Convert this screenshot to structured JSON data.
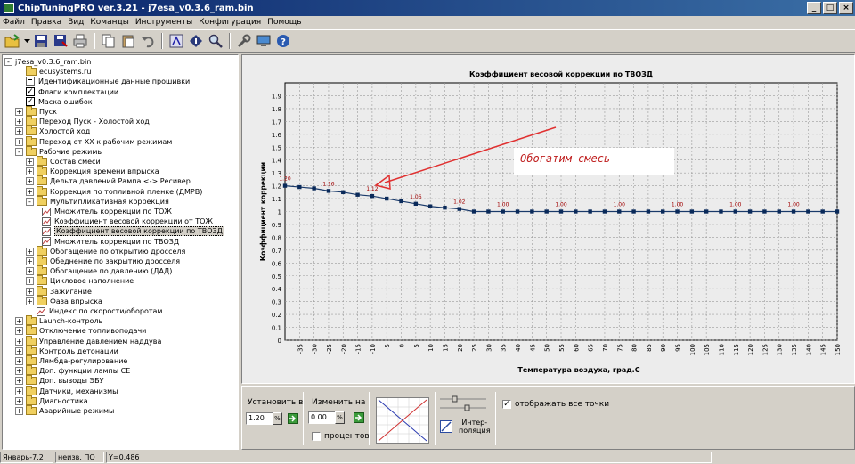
{
  "window": {
    "title": "ChipTuningPRO ver.3.21 - j7esa_v0.3.6_ram.bin",
    "buttons": {
      "minimize": "_",
      "maximize": "□",
      "close": "×"
    }
  },
  "menu": [
    "Файл",
    "Правка",
    "Вид",
    "Команды",
    "Инструменты",
    "Конфигурация",
    "Помощь"
  ],
  "toolbar_icons": [
    "open-icon",
    "dropdown-icon",
    "save-icon",
    "save-as-icon",
    "print-icon",
    "copy-icon",
    "paste-icon",
    "undo-icon",
    "find-icon",
    "info-icon",
    "zoom-icon",
    "tools-icon",
    "monitor-icon",
    "help-icon"
  ],
  "tree": [
    {
      "label": "j7esa_v0.3.6_ram.bin",
      "level": 0,
      "toggle": "-",
      "icon": "none"
    },
    {
      "label": "ecusystems.ru",
      "level": 1,
      "toggle": "",
      "icon": "folder"
    },
    {
      "label": "Идентификационные данные прошивки",
      "level": 1,
      "toggle": "",
      "icon": "doc"
    },
    {
      "label": "Флаги комплектации",
      "level": 1,
      "toggle": "",
      "icon": "check"
    },
    {
      "label": "Маска ошибок",
      "level": 1,
      "toggle": "",
      "icon": "check"
    },
    {
      "label": "Пуск",
      "level": 1,
      "toggle": "+",
      "icon": "folder"
    },
    {
      "label": "Переход Пуск - Холостой ход",
      "level": 1,
      "toggle": "+",
      "icon": "folder"
    },
    {
      "label": "Холостой ход",
      "level": 1,
      "toggle": "+",
      "icon": "folder"
    },
    {
      "label": "Переход от ХХ к рабочим режимам",
      "level": 1,
      "toggle": "+",
      "icon": "folder"
    },
    {
      "label": "Рабочие режимы",
      "level": 1,
      "toggle": "-",
      "icon": "folder"
    },
    {
      "label": "Состав смеси",
      "level": 2,
      "toggle": "+",
      "icon": "folder"
    },
    {
      "label": "Коррекция времени впрыска",
      "level": 2,
      "toggle": "+",
      "icon": "folder"
    },
    {
      "label": "Дельта давлений Рампа <-> Ресивер",
      "level": 2,
      "toggle": "+",
      "icon": "folder"
    },
    {
      "label": "Коррекция по топливной пленке (ДМРВ)",
      "level": 2,
      "toggle": "+",
      "icon": "folder"
    },
    {
      "label": "Мультипликативная коррекция",
      "level": 2,
      "toggle": "-",
      "icon": "folder"
    },
    {
      "label": "Множитель коррекции по ТОЖ",
      "level": 3,
      "toggle": "",
      "icon": "graph"
    },
    {
      "label": "Коэффициент весовой коррекции от ТОЖ",
      "level": 3,
      "toggle": "",
      "icon": "graph"
    },
    {
      "label": "Коэффициент весовой коррекции по ТВОЗД",
      "level": 3,
      "toggle": "",
      "icon": "graph",
      "selected": true
    },
    {
      "label": "Множитель коррекции по ТВОЗД",
      "level": 3,
      "toggle": "",
      "icon": "graph"
    },
    {
      "label": "Обогащение по открытию дросселя",
      "level": 2,
      "toggle": "+",
      "icon": "folder"
    },
    {
      "label": "Обеднение по закрытию дросселя",
      "level": 2,
      "toggle": "+",
      "icon": "folder"
    },
    {
      "label": "Обогащение по давлению (ДАД)",
      "level": 2,
      "toggle": "+",
      "icon": "folder"
    },
    {
      "label": "Цикловое наполнение",
      "level": 2,
      "toggle": "+",
      "icon": "folder"
    },
    {
      "label": "Зажигание",
      "level": 2,
      "toggle": "+",
      "icon": "folder"
    },
    {
      "label": "Фаза впрыска",
      "level": 2,
      "toggle": "+",
      "icon": "folder"
    },
    {
      "label": "Индекс по скорости/оборотам",
      "level": 2,
      "toggle": "",
      "icon": "graph"
    },
    {
      "label": "Launch-контроль",
      "level": 1,
      "toggle": "+",
      "icon": "folder"
    },
    {
      "label": "Отключение топливоподачи",
      "level": 1,
      "toggle": "+",
      "icon": "folder"
    },
    {
      "label": "Управление давлением наддува",
      "level": 1,
      "toggle": "+",
      "icon": "folder"
    },
    {
      "label": "Контроль детонации",
      "level": 1,
      "toggle": "+",
      "icon": "folder"
    },
    {
      "label": "Лямбда-регулирование",
      "level": 1,
      "toggle": "+",
      "icon": "folder"
    },
    {
      "label": "Доп. функции лампы CE",
      "level": 1,
      "toggle": "+",
      "icon": "folder"
    },
    {
      "label": "Доп. выводы ЭБУ",
      "level": 1,
      "toggle": "+",
      "icon": "folder"
    },
    {
      "label": "Датчики, механизмы",
      "level": 1,
      "toggle": "+",
      "icon": "folder"
    },
    {
      "label": "Диагностика",
      "level": 1,
      "toggle": "+",
      "icon": "folder"
    },
    {
      "label": "Аварийные режимы",
      "level": 1,
      "toggle": "+",
      "icon": "folder"
    }
  ],
  "chart_data": {
    "type": "line",
    "title": "Коэффициент весовой коррекции по ТВОЗД",
    "xlabel": "Температура воздуха, град.С",
    "ylabel": "Коэффициент коррекции",
    "x": [
      -40,
      -35,
      -30,
      -25,
      -20,
      -15,
      -10,
      -5,
      0,
      5,
      10,
      15,
      20,
      25,
      30,
      35,
      40,
      45,
      50,
      55,
      60,
      65,
      70,
      75,
      80,
      85,
      90,
      95,
      100,
      105,
      110,
      115,
      120,
      125,
      130,
      135,
      140,
      145,
      150
    ],
    "values": [
      1.2,
      1.19,
      1.18,
      1.16,
      1.15,
      1.13,
      1.12,
      1.1,
      1.08,
      1.06,
      1.04,
      1.03,
      1.02,
      1.0,
      1.0,
      1.0,
      1.0,
      1.0,
      1.0,
      1.0,
      1.0,
      1.0,
      1.0,
      1.0,
      1.0,
      1.0,
      1.0,
      1.0,
      1.0,
      1.0,
      1.0,
      1.0,
      1.0,
      1.0,
      1.0,
      1.0,
      1.0,
      1.0,
      1.0
    ],
    "data_labels": [
      {
        "x": -40,
        "text": "1.20"
      },
      {
        "x": -25,
        "text": "1.16"
      },
      {
        "x": -10,
        "text": "1.12"
      },
      {
        "x": 5,
        "text": "1.06"
      },
      {
        "x": 20,
        "text": "1.02"
      },
      {
        "x": 35,
        "text": "1.00"
      },
      {
        "x": 55,
        "text": "1.00"
      },
      {
        "x": 75,
        "text": "1.00"
      },
      {
        "x": 95,
        "text": "1.00"
      },
      {
        "x": 115,
        "text": "1.00"
      },
      {
        "x": 135,
        "text": "1.00"
      }
    ],
    "xticks": [
      -35,
      -30,
      -25,
      -20,
      -15,
      -10,
      -5,
      0,
      5,
      10,
      15,
      20,
      25,
      30,
      35,
      40,
      45,
      50,
      55,
      60,
      65,
      70,
      75,
      80,
      85,
      90,
      95,
      100,
      105,
      110,
      115,
      120,
      125,
      130,
      135,
      140,
      145,
      150
    ],
    "yticks": [
      0,
      0.1,
      0.2,
      0.3,
      0.4,
      0.5,
      0.6,
      0.7,
      0.8,
      0.9,
      1,
      1.1,
      1.2,
      1.3,
      1.4,
      1.5,
      1.6,
      1.7,
      1.8,
      1.9
    ],
    "xlim": [
      -40,
      150
    ],
    "ylim": [
      0,
      2
    ],
    "grid": true,
    "annotation": "Обогатим смесь",
    "line_color": "#1a3a6a",
    "marker_color": "#0a2a5a",
    "label_color": "#a00000",
    "arrow_color": "#e03030"
  },
  "controls": {
    "set_label": "Установить в",
    "set_value": "1.20",
    "change_label": "Изменить на",
    "change_value": "0.00",
    "percent_label": "процентов",
    "interp_label": "Интер-\nполяция",
    "show_points_label": "отображать все точки",
    "percent_symbol": "%"
  },
  "status": {
    "profile": "Январь-7.2",
    "state": "неизв. ПО",
    "y_readout": "Y=0.486"
  }
}
